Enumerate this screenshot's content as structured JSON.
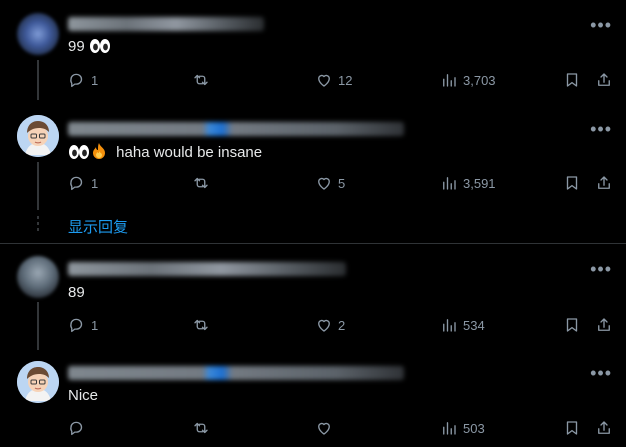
{
  "posts": [
    {
      "text": "99",
      "emoji": "eyes",
      "replies": "1",
      "likes": "12",
      "views": "3,703"
    },
    {
      "text": "haha would be insane",
      "emoji": "eyes-fire",
      "replies": "1",
      "likes": "5",
      "views": "3,591"
    },
    {
      "text": "89",
      "replies": "1",
      "likes": "2",
      "views": "534"
    },
    {
      "text": "Nice",
      "replies": "",
      "likes": "",
      "views": "503"
    }
  ],
  "show_replies_label": "显示回复",
  "more_label": "•••",
  "colors": {
    "background": "#000000",
    "text": "#e7e9ea",
    "muted": "#8b98a5",
    "accent": "#1d9bf0",
    "divider": "#2f3336"
  }
}
